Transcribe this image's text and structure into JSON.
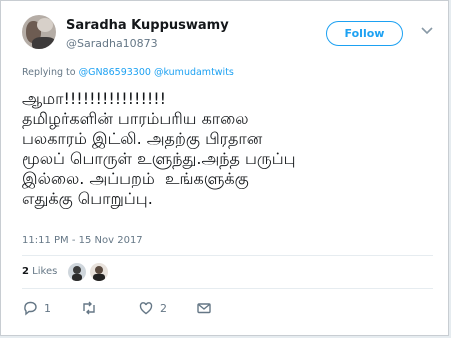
{
  "author": {
    "display_name": "Saradha Kuppuswamy",
    "handle": "@Saradha10873"
  },
  "follow_button": {
    "label": "Follow"
  },
  "reply_context": {
    "prefix": "Replying to",
    "mentions": [
      "@GN86593300",
      "@kumudamtwits"
    ]
  },
  "tweet": {
    "lines": [
      "ஆமா!!!!!!!!!!!!!!!!",
      "தமிழர்களின் பாரம்பரிய காலை",
      "பலகாரம் இட்லி. அதற்கு பிரதான",
      "மூலப் பொருள் உளுந்து.அந்த பருப்பு",
      "இல்லை. அப்பறம்  உங்களுக்கு",
      "எதுக்கு பொறுப்பு."
    ],
    "timestamp": "11:11 PM - 15 Nov 2017"
  },
  "engagement": {
    "likes_count": "2",
    "likes_label": "Likes"
  },
  "actions": {
    "reply_count": "1",
    "retweet_count": "",
    "like_count": "2"
  },
  "icons": [
    "avatar",
    "chevron-down-icon",
    "reply-icon",
    "retweet-icon",
    "heart-icon",
    "message-icon"
  ],
  "colors": {
    "accent": "#1da1f2",
    "secondary_text": "#657786",
    "text": "#14171a"
  }
}
